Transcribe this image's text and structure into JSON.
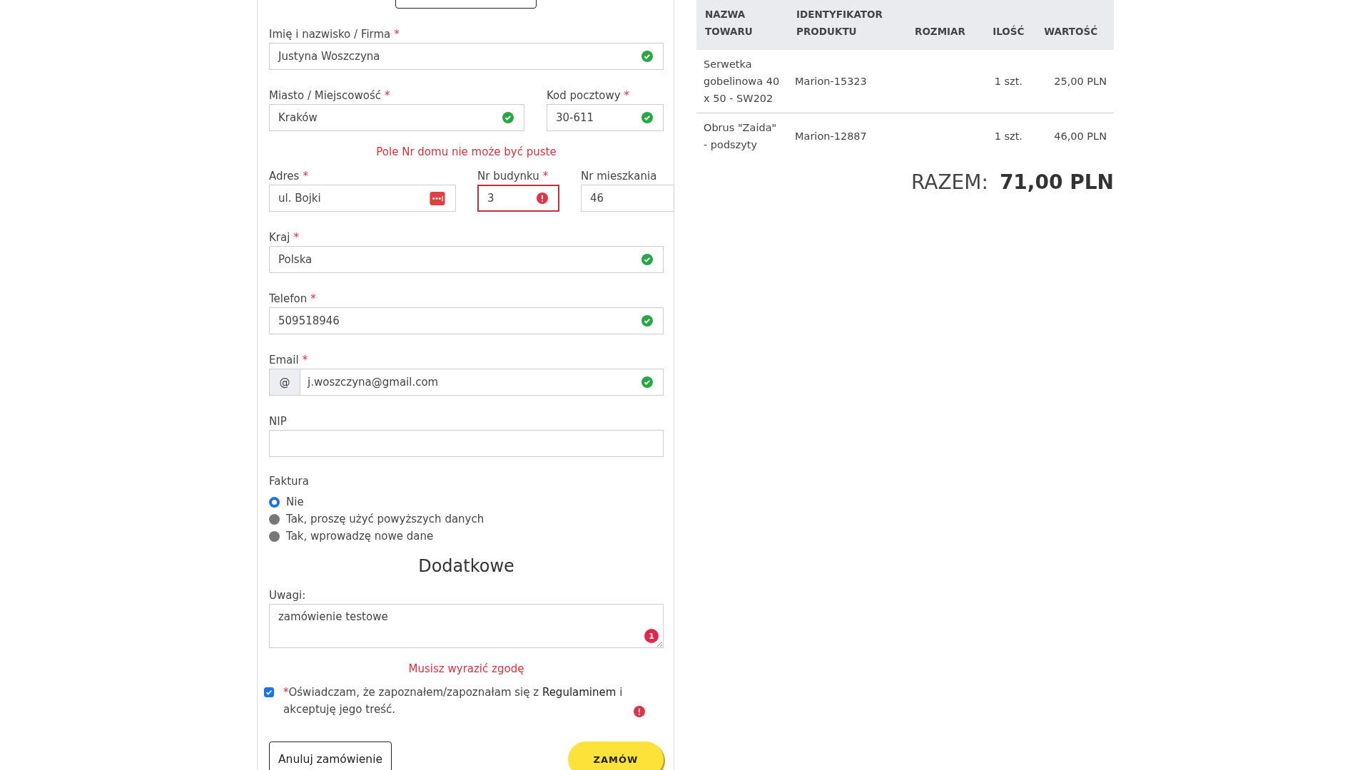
{
  "form": {
    "items": [
      {
        "kind": "fields",
        "fields": [
          {
            "label": "Imię i nazwisko / Firma",
            "required": true,
            "value": "Justyna Woszczyna",
            "valid": true,
            "error": false,
            "autofill": false
          }
        ]
      },
      {
        "kind": "fields",
        "fields": [
          {
            "label": "Miasto / Miejscowość",
            "required": true,
            "value": "Kraków",
            "valid": true,
            "error": false,
            "autofill": false
          },
          {
            "label": "Kod pocztowy",
            "required": true,
            "value": "30-611",
            "valid": true,
            "error": false,
            "autofill": false
          }
        ]
      },
      {
        "kind": "error",
        "text": "Pole Nr domu nie może być puste"
      },
      {
        "kind": "fields",
        "fields": [
          {
            "label": "Adres",
            "required": true,
            "value": "ul. Bojki",
            "valid": false,
            "error": false,
            "autofill": true
          },
          {
            "label": "Nr budynku",
            "required": true,
            "value": "3",
            "valid": false,
            "error": true,
            "autofill": false
          },
          {
            "label": "Nr mieszkania",
            "required": false,
            "value": "46",
            "valid": false,
            "error": false,
            "autofill": false
          }
        ]
      },
      {
        "kind": "fields",
        "fields": [
          {
            "label": "Kraj",
            "required": true,
            "value": "Polska",
            "valid": true,
            "error": false,
            "autofill": false
          }
        ]
      },
      {
        "kind": "fields",
        "fields": [
          {
            "label": "Telefon",
            "required": true,
            "value": "509518946",
            "valid": true,
            "error": false,
            "autofill": false
          }
        ]
      },
      {
        "kind": "fields",
        "fields": [
          {
            "label": "Email",
            "required": true,
            "value": "j.woszczyna@gmail.com",
            "valid": true,
            "error": false,
            "autofill": false,
            "prefix": "@"
          }
        ]
      },
      {
        "kind": "fields",
        "fields": [
          {
            "label": "NIP",
            "required": false,
            "valid": false,
            "error": false,
            "autofill": false
          }
        ]
      },
      {
        "kind": "radios",
        "label": "Faktura",
        "options": [
          {
            "label": "Nie",
            "selected": true
          },
          {
            "label": "Tak, proszę użyć powyższych danych",
            "selected": false
          },
          {
            "label": "Tak, wprowadzę nowe dane",
            "selected": false
          }
        ]
      },
      {
        "kind": "heading",
        "text": "Dodatkowe"
      },
      {
        "kind": "textarea",
        "label": "Uwagi:",
        "value": "zamówienie testowe",
        "badge": "1"
      },
      {
        "kind": "error",
        "text": "Musisz wyrazić zgodę"
      },
      {
        "kind": "consent",
        "checked": true,
        "mark": "*",
        "text": "Oświadczam, że zapoznałem/zapoznałam się z",
        "link": "Regulaminem",
        "after": "i akceptuję jego treść.",
        "error": true
      },
      {
        "kind": "buttons",
        "cancel": "Anuluj zamówienie",
        "submit": "ZAMÓW"
      }
    ]
  },
  "order": {
    "columns": [
      "NAZWA TOWARU",
      "IDENTYFIKATOR PRODUKTU",
      "ROZMIAR",
      "ILOŚĆ",
      "WARTOŚĆ"
    ],
    "rows": [
      [
        "Serwetka gobelinowa 40 x 50 - SW202",
        "Marion-15323",
        "",
        "1 szt.",
        "25,00 PLN"
      ],
      [
        "Obrus \"Zaida\" - podszyty",
        "Marion-12887",
        "",
        "1 szt.",
        "46,00 PLN"
      ]
    ],
    "total_label": "RAZEM:",
    "total_value": "71,00 PLN"
  }
}
